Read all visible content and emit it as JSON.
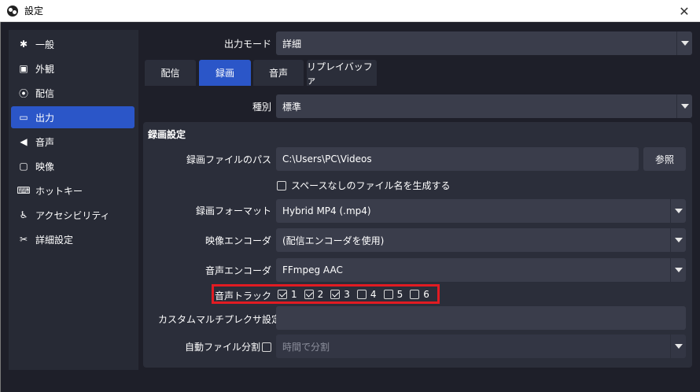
{
  "titlebar": {
    "title": "設定",
    "close_glyph": "✕"
  },
  "sidebar": {
    "items": [
      {
        "label": "一般",
        "icon": "gear-icon",
        "glyph": "✱",
        "active": false
      },
      {
        "label": "外観",
        "icon": "appearance-icon",
        "glyph": "▣",
        "active": false
      },
      {
        "label": "配信",
        "icon": "broadcast-icon",
        "glyph": "⦿",
        "active": false
      },
      {
        "label": "出力",
        "icon": "output-icon",
        "glyph": "▭",
        "active": true
      },
      {
        "label": "音声",
        "icon": "speaker-icon",
        "glyph": "◀",
        "active": false
      },
      {
        "label": "映像",
        "icon": "monitor-icon",
        "glyph": "▢",
        "active": false
      },
      {
        "label": "ホットキー",
        "icon": "keyboard-icon",
        "glyph": "⌨",
        "active": false
      },
      {
        "label": "アクセシビリティ",
        "icon": "accessibility-icon",
        "glyph": "♿",
        "active": false
      },
      {
        "label": "詳細設定",
        "icon": "tools-icon",
        "glyph": "✂",
        "active": false
      }
    ]
  },
  "output_mode": {
    "label": "出力モード",
    "value": "詳細"
  },
  "tabs": [
    {
      "label": "配信",
      "active": false
    },
    {
      "label": "録画",
      "active": true
    },
    {
      "label": "音声",
      "active": false
    },
    {
      "label": "リプレイバッファ",
      "active": false
    }
  ],
  "type_row": {
    "label": "種別",
    "value": "標準"
  },
  "recording": {
    "section_title": "録画設定",
    "path_label": "録画ファイルのパス",
    "path_value": "C:\\Users\\PC\\Videos",
    "browse_label": "参照",
    "nospace_label": "スペースなしのファイル名を生成する",
    "format_label": "録画フォーマット",
    "format_value": "Hybrid MP4 (.mp4)",
    "video_encoder_label": "映像エンコーダ",
    "video_encoder_value": "(配信エンコーダを使用)",
    "audio_encoder_label": "音声エンコーダ",
    "audio_encoder_value": "FFmpeg AAC",
    "audio_track_label": "音声トラック",
    "tracks": [
      {
        "num": "1",
        "checked": true
      },
      {
        "num": "2",
        "checked": true
      },
      {
        "num": "3",
        "checked": true
      },
      {
        "num": "4",
        "checked": false
      },
      {
        "num": "5",
        "checked": false
      },
      {
        "num": "6",
        "checked": false
      }
    ],
    "muxer_label": "カスタムマルチプレクサ設定",
    "muxer_value": "",
    "autosplit_label": "自動ファイル分割",
    "autosplit_value": "時間で分割"
  },
  "colors": {
    "accent": "#2b56c8",
    "highlight": "#e11b22",
    "background": "#1e1f29",
    "panel": "#2b2e3a",
    "field": "#3a3d4b"
  }
}
